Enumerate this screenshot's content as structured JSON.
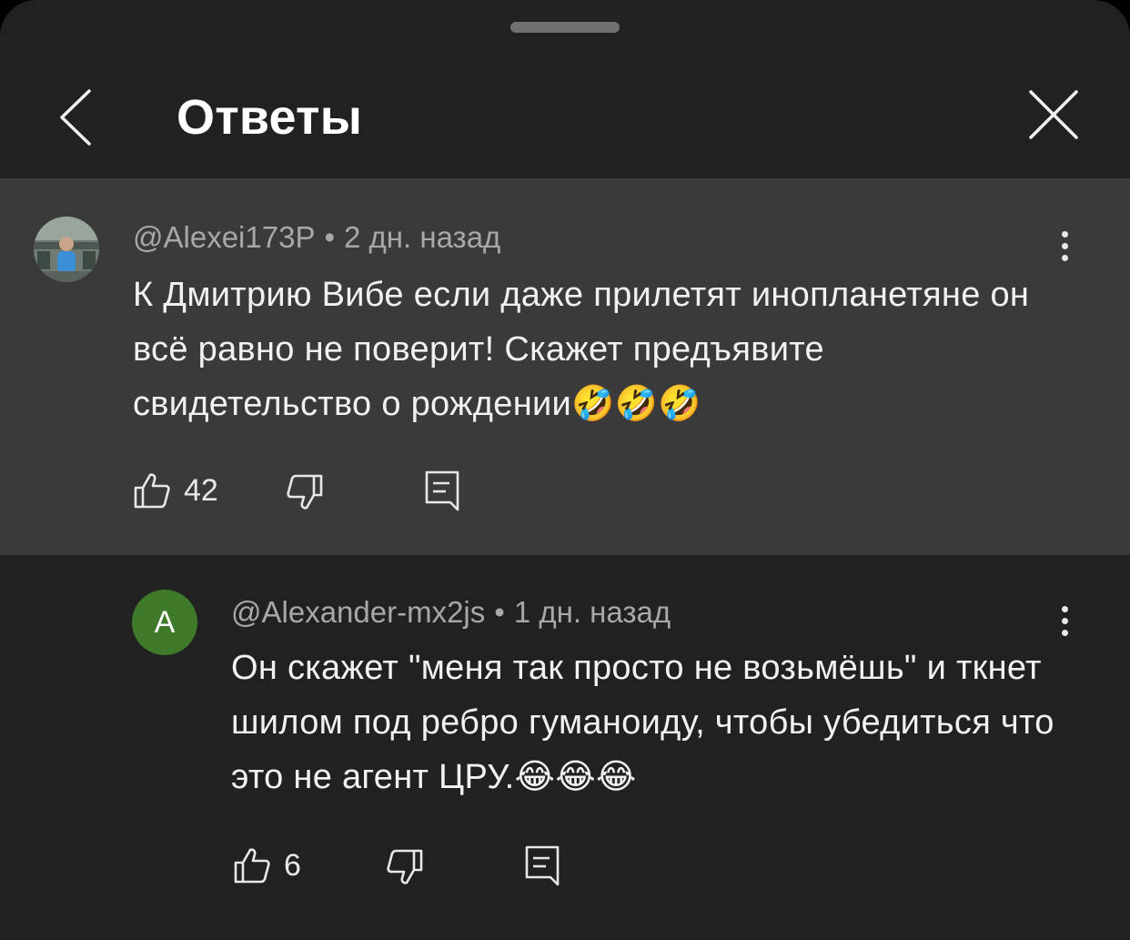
{
  "header": {
    "title": "Ответы"
  },
  "comments": [
    {
      "author": "@Alexei173P",
      "time": "2 дн. назад",
      "text": "К  Дмитрию Вибе если даже прилетят инопланетяне он всё равно не поверит! Скажет предъявите  свидетельство о рождении🤣🤣🤣",
      "likes": "42"
    },
    {
      "author": "@Alexander-mx2js",
      "avatar_letter": "A",
      "avatar_color": "#3e7a2a",
      "time": "1 дн. назад",
      "text": "Он скажет \"меня так просто не возьмёшь\" и ткнет шилом под ребро гуманоиду, чтобы убедиться что это не агент ЦРУ.😂😂😂",
      "likes": "6"
    }
  ],
  "icons": {
    "back": "chevron-left-icon",
    "close": "close-icon",
    "more": "more-vert-icon",
    "like": "thumb-up-icon",
    "dislike": "thumb-down-icon",
    "reply": "comment-icon"
  },
  "colors": {
    "sheet": "#212121",
    "highlight": "#3a3a3a",
    "meta_text": "#a8a8a8"
  }
}
